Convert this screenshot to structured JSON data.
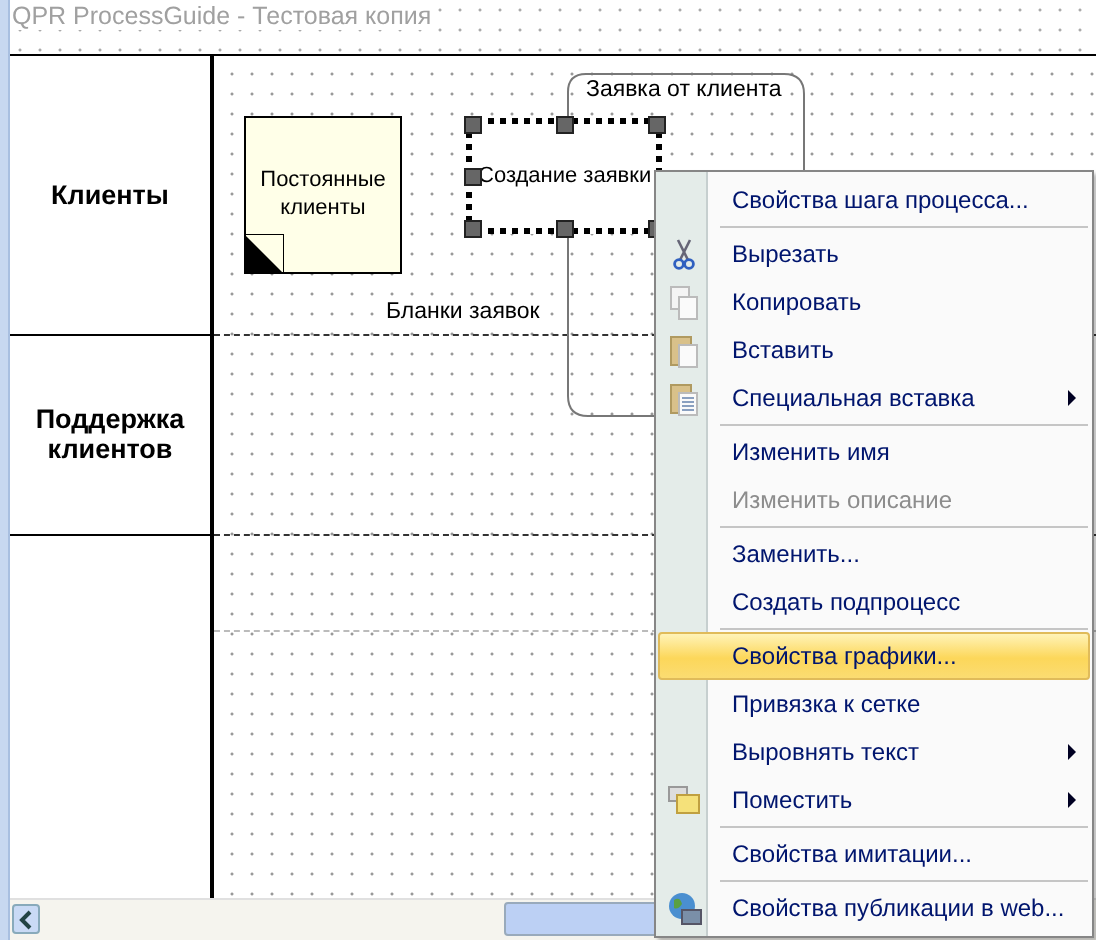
{
  "title": "QPR ProcessGuide - Тестовая копия",
  "lanes": [
    {
      "label": "Клиенты"
    },
    {
      "label": "Поддержка клиентов"
    }
  ],
  "diagram": {
    "store": {
      "label": "Постоянные клиенты"
    },
    "step": {
      "label": "Создание заявки",
      "selected": true
    },
    "flows": [
      {
        "label": "Заявка от клиента"
      },
      {
        "label": "Бланки заявок"
      }
    ]
  },
  "menu": [
    {
      "kind": "item",
      "label": "Свойства шага процесса...",
      "disabled": false,
      "selected": false,
      "submenu": false
    },
    {
      "kind": "separator"
    },
    {
      "kind": "item",
      "label": "Вырезать",
      "disabled": false,
      "selected": false,
      "submenu": false
    },
    {
      "kind": "item",
      "label": "Копировать",
      "disabled": false,
      "selected": false,
      "submenu": false
    },
    {
      "kind": "item",
      "label": "Вставить",
      "disabled": false,
      "selected": false,
      "submenu": false
    },
    {
      "kind": "item",
      "label": "Специальная вставка",
      "disabled": false,
      "selected": false,
      "submenu": true
    },
    {
      "kind": "separator"
    },
    {
      "kind": "item",
      "label": "Изменить имя",
      "disabled": false,
      "selected": false,
      "submenu": false
    },
    {
      "kind": "item",
      "label": "Изменить описание",
      "disabled": true,
      "selected": false,
      "submenu": false
    },
    {
      "kind": "separator"
    },
    {
      "kind": "item",
      "label": "Заменить...",
      "disabled": false,
      "selected": false,
      "submenu": false
    },
    {
      "kind": "item",
      "label": "Создать подпроцесс",
      "disabled": false,
      "selected": false,
      "submenu": false
    },
    {
      "kind": "separator"
    },
    {
      "kind": "item",
      "label": "Свойства графики...",
      "disabled": false,
      "selected": true,
      "submenu": false
    },
    {
      "kind": "item",
      "label": "Привязка к сетке",
      "disabled": false,
      "selected": false,
      "submenu": false
    },
    {
      "kind": "item",
      "label": "Выровнять текст",
      "disabled": false,
      "selected": false,
      "submenu": true
    },
    {
      "kind": "item",
      "label": "Поместить",
      "disabled": false,
      "selected": false,
      "submenu": true
    },
    {
      "kind": "separator"
    },
    {
      "kind": "item",
      "label": "Свойства имитации...",
      "disabled": false,
      "selected": false,
      "submenu": false
    },
    {
      "kind": "separator"
    },
    {
      "kind": "item",
      "label": "Свойства публикации в web...",
      "disabled": false,
      "selected": false,
      "submenu": false
    }
  ]
}
